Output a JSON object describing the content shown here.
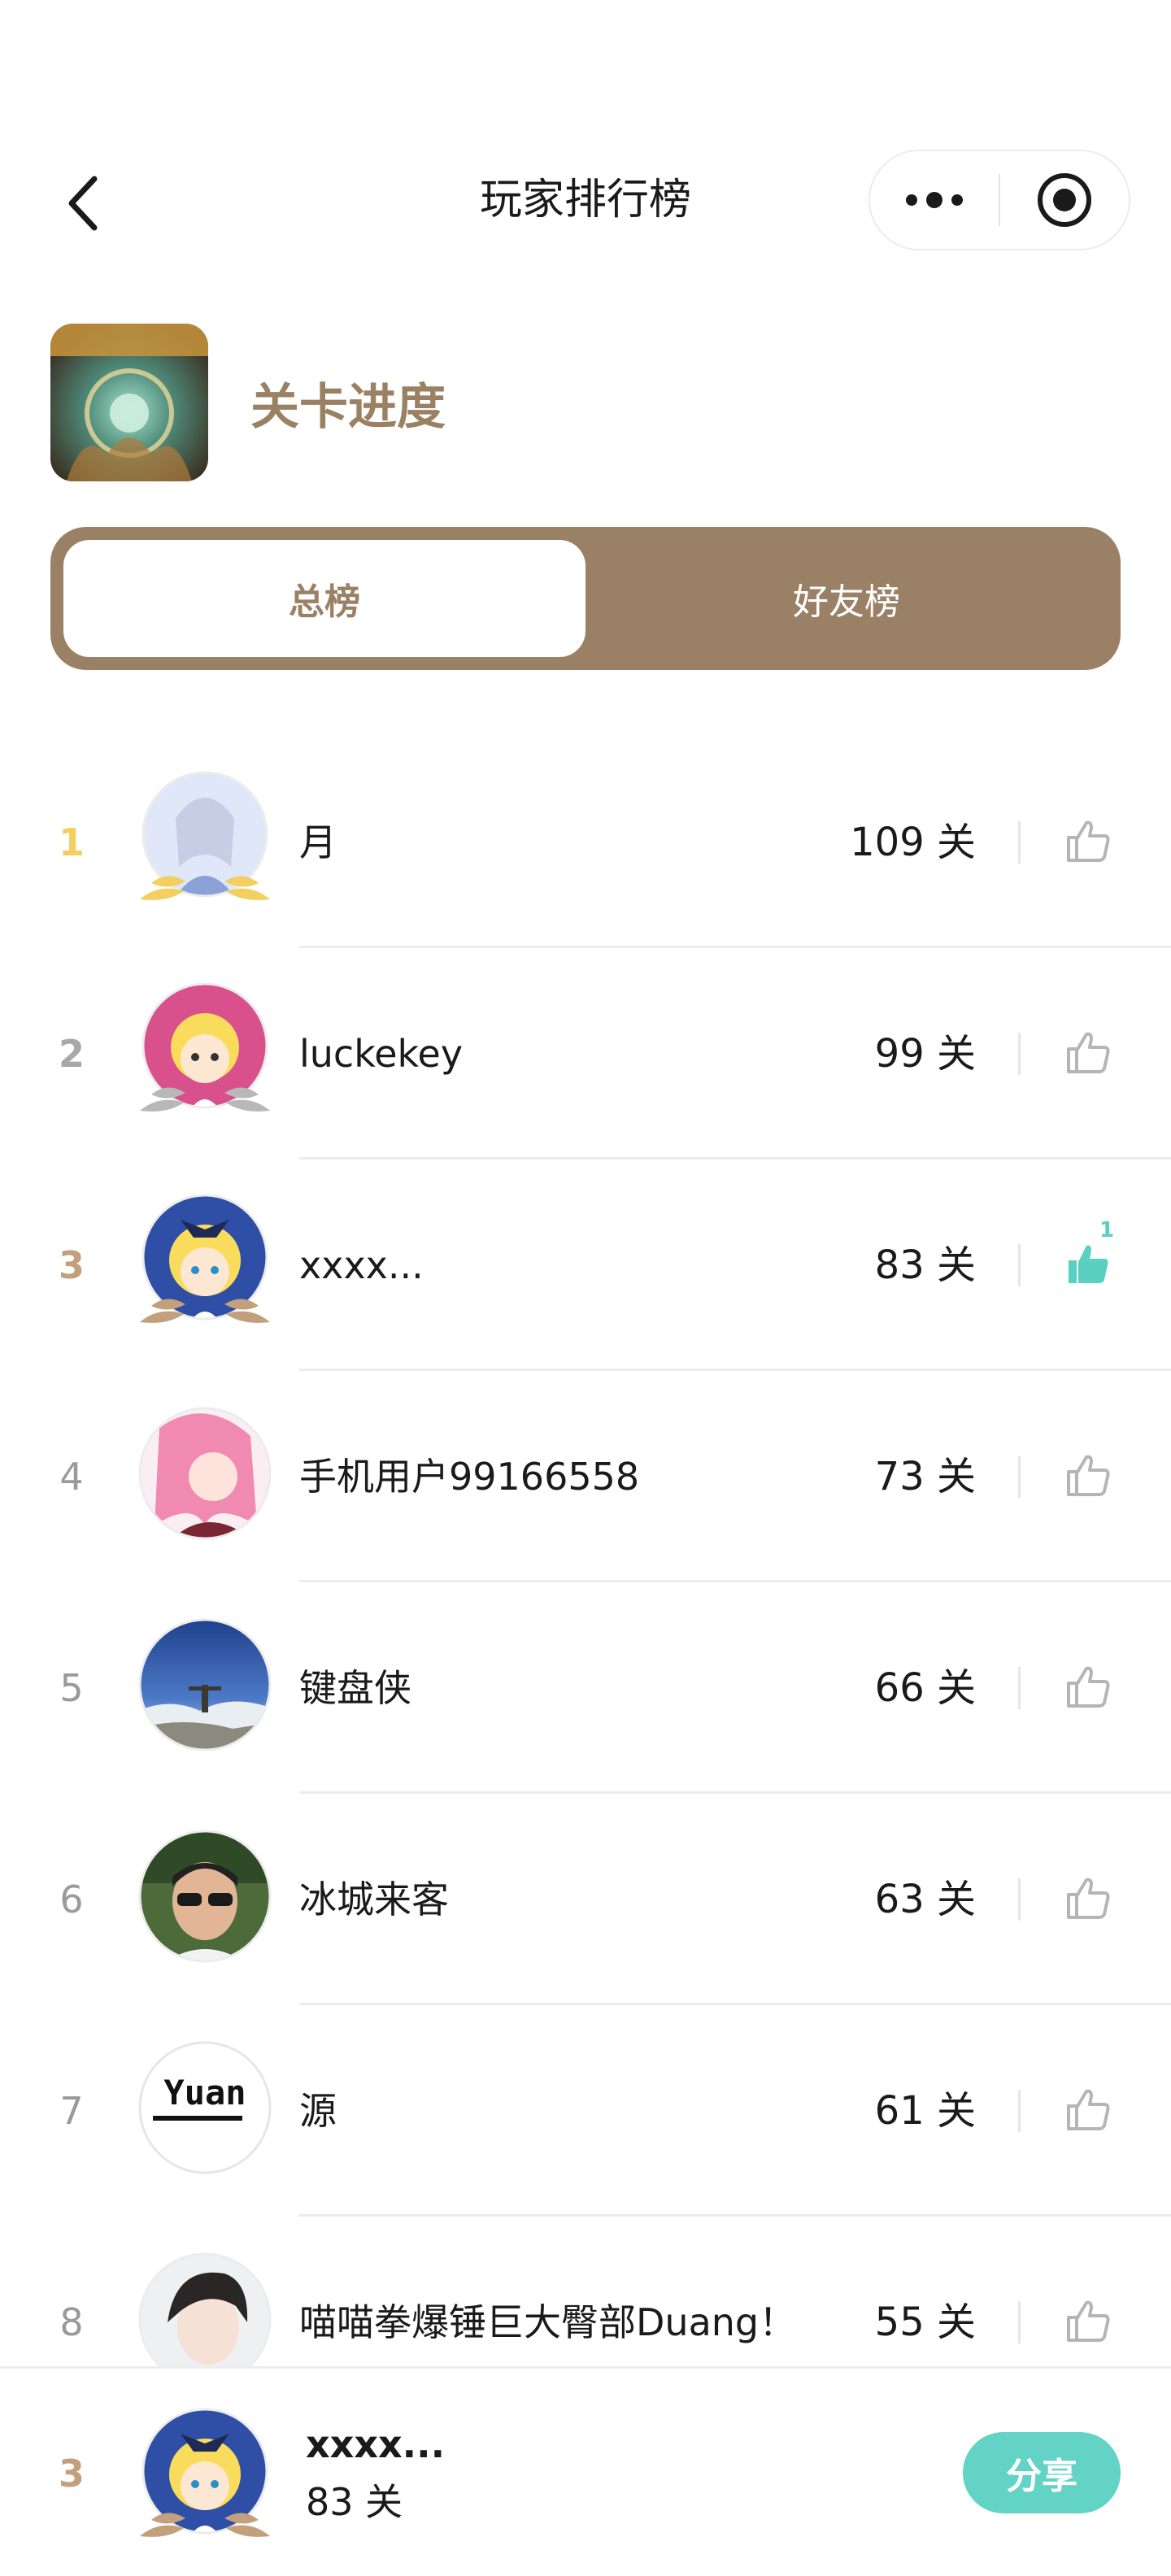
{
  "nav": {
    "title": "玩家排行榜"
  },
  "header": {
    "board_title": "关卡进度"
  },
  "tabs": [
    {
      "label": "总榜",
      "active": true
    },
    {
      "label": "好友榜",
      "active": false
    }
  ],
  "colors": {
    "brand_brown": "#9a8166",
    "accent_teal": "#5ad0c2",
    "gold": "#f2cf5e",
    "silver": "#a8a8a8",
    "bronze": "#c3a07c"
  },
  "ranking": [
    {
      "rank": "1",
      "name": "月",
      "score": "109 关",
      "liked": false,
      "like_count": ""
    },
    {
      "rank": "2",
      "name": "luckekey",
      "score": "99 关",
      "liked": false,
      "like_count": ""
    },
    {
      "rank": "3",
      "name": "xxxx...",
      "score": "83 关",
      "liked": true,
      "like_count": "1"
    },
    {
      "rank": "4",
      "name": "手机用户99166558",
      "score": "73 关",
      "liked": false,
      "like_count": ""
    },
    {
      "rank": "5",
      "name": "键盘侠",
      "score": "66 关",
      "liked": false,
      "like_count": ""
    },
    {
      "rank": "6",
      "name": "冰城来客",
      "score": "63 关",
      "liked": false,
      "like_count": ""
    },
    {
      "rank": "7",
      "name": "源",
      "score": "61 关",
      "liked": false,
      "like_count": ""
    },
    {
      "rank": "8",
      "name": "喵喵拳爆锤巨大臀部Duang！",
      "score": "55 关",
      "liked": false,
      "like_count": ""
    }
  ],
  "me": {
    "rank": "3",
    "name": "xxxx...",
    "score": "83 关",
    "share_label": "分享"
  },
  "avatar_texts": {
    "yuan_logo": "Yuan"
  }
}
